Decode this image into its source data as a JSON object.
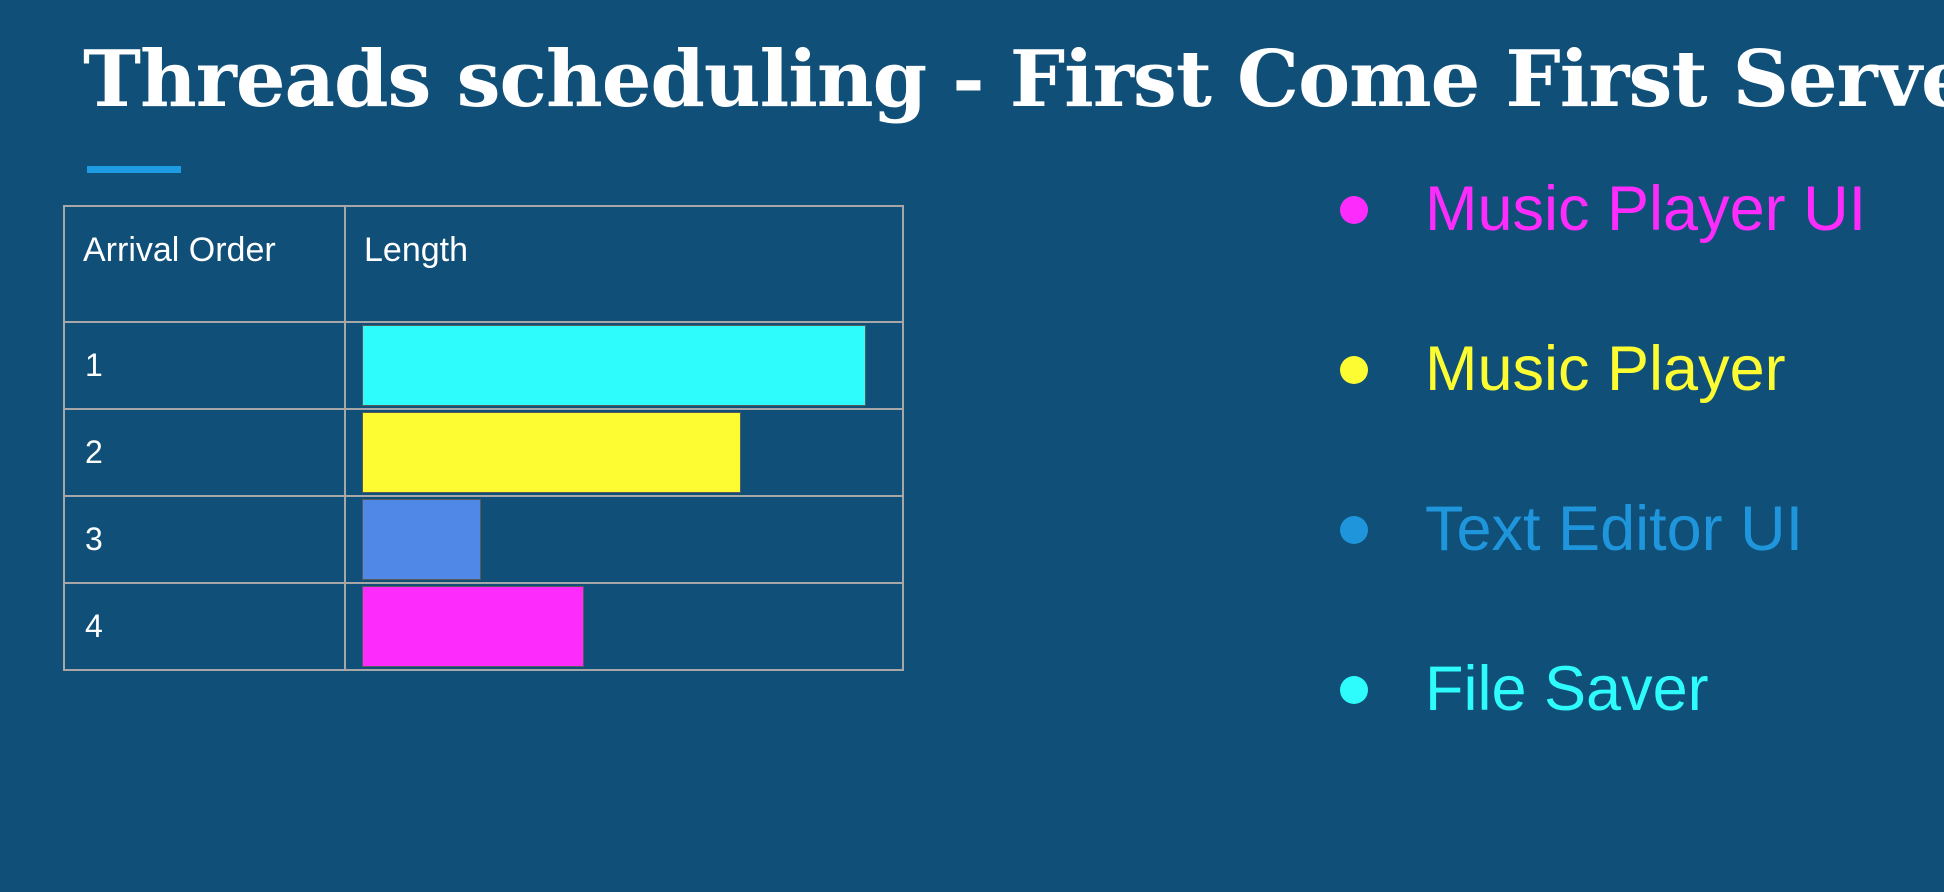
{
  "title": "Threads scheduling - First Come First Serve",
  "table": {
    "headers": [
      "Arrival Order",
      "Length"
    ],
    "rows": [
      {
        "order": "1",
        "length_fraction": 0.93,
        "color": "#2efcfc"
      },
      {
        "order": "2",
        "length_fraction": 0.7,
        "color": "#fdfc32"
      },
      {
        "order": "3",
        "length_fraction": 0.22,
        "color": "#4f88e6"
      },
      {
        "order": "4",
        "length_fraction": 0.41,
        "color": "#fd2cfc"
      }
    ]
  },
  "legend": [
    {
      "label": "Music Player UI",
      "color": "#fd2cfc"
    },
    {
      "label": "Music Player",
      "color": "#fdfc32"
    },
    {
      "label": "Text Editor UI",
      "color": "#1f96dc"
    },
    {
      "label": "File Saver",
      "color": "#2efcfc"
    }
  ],
  "colors": {
    "background": "#0f4f78",
    "accent": "#1d9be3",
    "grid": "#a7a7a7"
  }
}
